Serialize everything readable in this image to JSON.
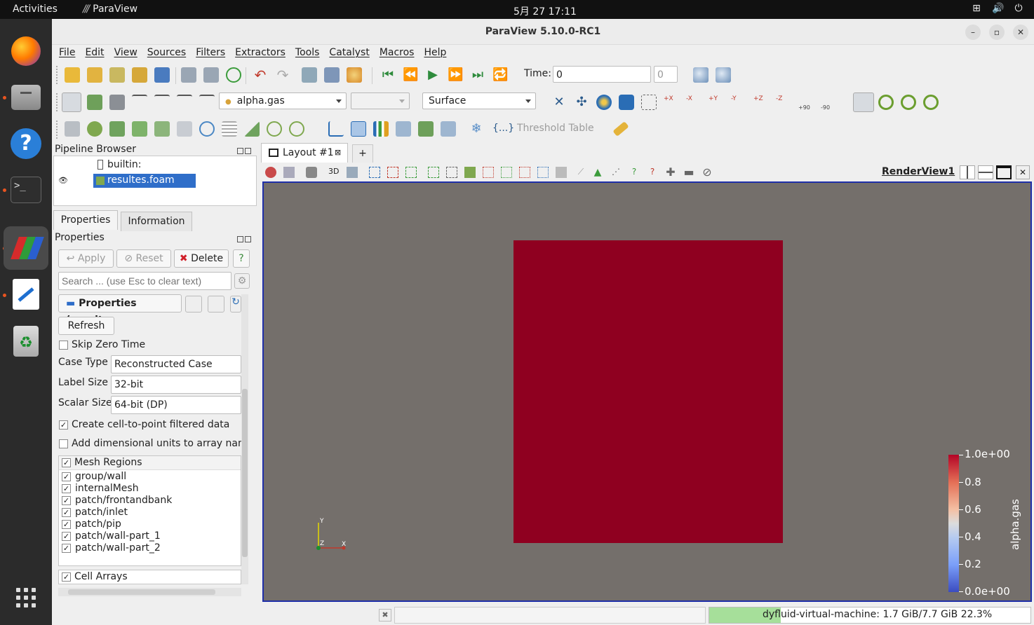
{
  "topbar": {
    "activities": "Activities",
    "app_name": "ParaView",
    "clock": "5月 27  17:11"
  },
  "window": {
    "title": "ParaView 5.10.0-RC1"
  },
  "menu": [
    "File",
    "Edit",
    "View",
    "Sources",
    "Filters",
    "Extractors",
    "Tools",
    "Catalyst",
    "Macros",
    "Help"
  ],
  "toolbar_main": {
    "time_label": "Time:",
    "time_value": "0",
    "timestep_value": "0"
  },
  "toolbar_display": {
    "color_by": "alpha.gas",
    "component": "",
    "representation": "Surface",
    "rot_plus": "+90",
    "rot_minus": "-90"
  },
  "toolbar_filters": {
    "threshold_table": "Threshold Table",
    "braces": "{...}"
  },
  "pipeline_browser": {
    "title": "Pipeline Browser",
    "items": [
      "builtin:",
      "resultes.foam"
    ]
  },
  "tabs": {
    "properties": "Properties",
    "information": "Information"
  },
  "properties": {
    "title": "Properties",
    "apply": "Apply",
    "reset": "Reset",
    "delete": "Delete",
    "help": "?",
    "search_placeholder": "Search ... (use Esc to clear text)",
    "section_title": "Properties (resulte",
    "refresh": "Refresh",
    "skip_zero_time": "Skip Zero Time",
    "skip_zero_time_checked": false,
    "case_type_label": "Case Type",
    "case_type_value": "Reconstructed Case",
    "label_size_label": "Label Size",
    "label_size_value": "32-bit",
    "scalar_size_label": "Scalar Size",
    "scalar_size_value": "64-bit (DP)",
    "cell_to_point": "Create cell-to-point filtered data",
    "cell_to_point_checked": true,
    "dim_units": "Add dimensional units to array name",
    "dim_units_checked": false,
    "mesh_regions_header": "Mesh Regions",
    "mesh_regions": [
      "group/wall",
      "internalMesh",
      "patch/frontandbank",
      "patch/inlet",
      "patch/pip",
      "patch/wall-part_1",
      "patch/wall-part_2"
    ],
    "cell_arrays_header": "Cell Arrays"
  },
  "layout": {
    "tab_label": "Layout #1",
    "add_tab": "+",
    "view_name": "RenderView1",
    "mode_3d": "3D"
  },
  "render": {
    "background_color": "#746f6b",
    "domain_color": "#8f0020",
    "axes": {
      "x": "X",
      "y": "Y",
      "z": "Z"
    },
    "colorbar": {
      "title": "alpha.gas",
      "labels": [
        "1.0e+00",
        "0.8",
        "0.6",
        "0.4",
        "0.2",
        "0.0e+00"
      ]
    }
  },
  "status": {
    "memory_text": "dyfluid-virtual-machine: 1.7 GiB/7.7 GiB 22.3%",
    "memory_fraction": 0.223
  }
}
